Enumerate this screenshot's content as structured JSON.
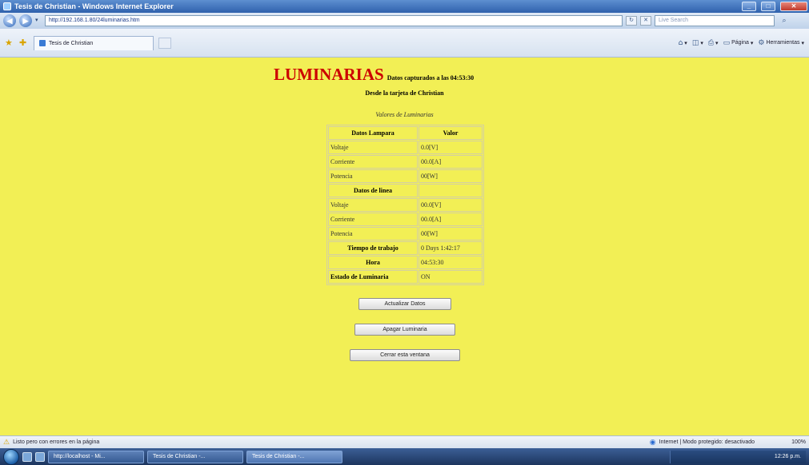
{
  "window": {
    "title": "Tesis de Christian - Windows Internet Explorer",
    "minimize": "_",
    "maximize": "□",
    "close": "✕"
  },
  "addressbar": {
    "url": "http://192.168.1.80/24luminarias.htm",
    "search_placeholder": "Live Search",
    "back_icon": "back-arrow-icon",
    "forward_icon": "forward-arrow-icon"
  },
  "tabs": [
    {
      "label": "Tesis de Christian"
    }
  ],
  "commandbar": {
    "page": "Página",
    "tools": "Herramientas"
  },
  "page": {
    "title": "LUMINARIAS",
    "capture_text": "Datos capturados a las 04:53:30",
    "subtitle": "Desde la tarjeta de Christian",
    "caption": "Valores de Luminarias",
    "table": {
      "header": [
        "Datos Lampara",
        "Valor"
      ],
      "lamp_rows": [
        {
          "label": "Voltaje",
          "value": "0.0[V]"
        },
        {
          "label": "Corriente",
          "value": "00.0[A]"
        },
        {
          "label": "Potencia",
          "value": "00[W]"
        }
      ],
      "line_section": "Datos de linea",
      "line_rows": [
        {
          "label": "Voltaje",
          "value": "00.0[V]"
        },
        {
          "label": "Corriente",
          "value": "00.0[A]"
        },
        {
          "label": "Potencia",
          "value": "00[W]"
        }
      ],
      "work_time": {
        "label": "Tiempo de trabajo",
        "value": "0 Days 1:42:17"
      },
      "hour": {
        "label": "Hora",
        "value": "04:53:30"
      },
      "status": {
        "label": "Estado de Luminaria",
        "value": "ON"
      }
    },
    "buttons": {
      "update": "Actualizar Datos",
      "turn_off": "Apagar Luminaria",
      "close": "Cerrar esta ventana"
    }
  },
  "statusbar": {
    "message": "Listo pero con errores en la página",
    "zone": "Internet | Modo protegido: desactivado",
    "zoom": "100%"
  },
  "taskbar": {
    "items": [
      "http://localhost - Mi...",
      "Tesis de Christian -...",
      "Tesis de Christian -..."
    ],
    "clock": "12:26 p.m."
  }
}
